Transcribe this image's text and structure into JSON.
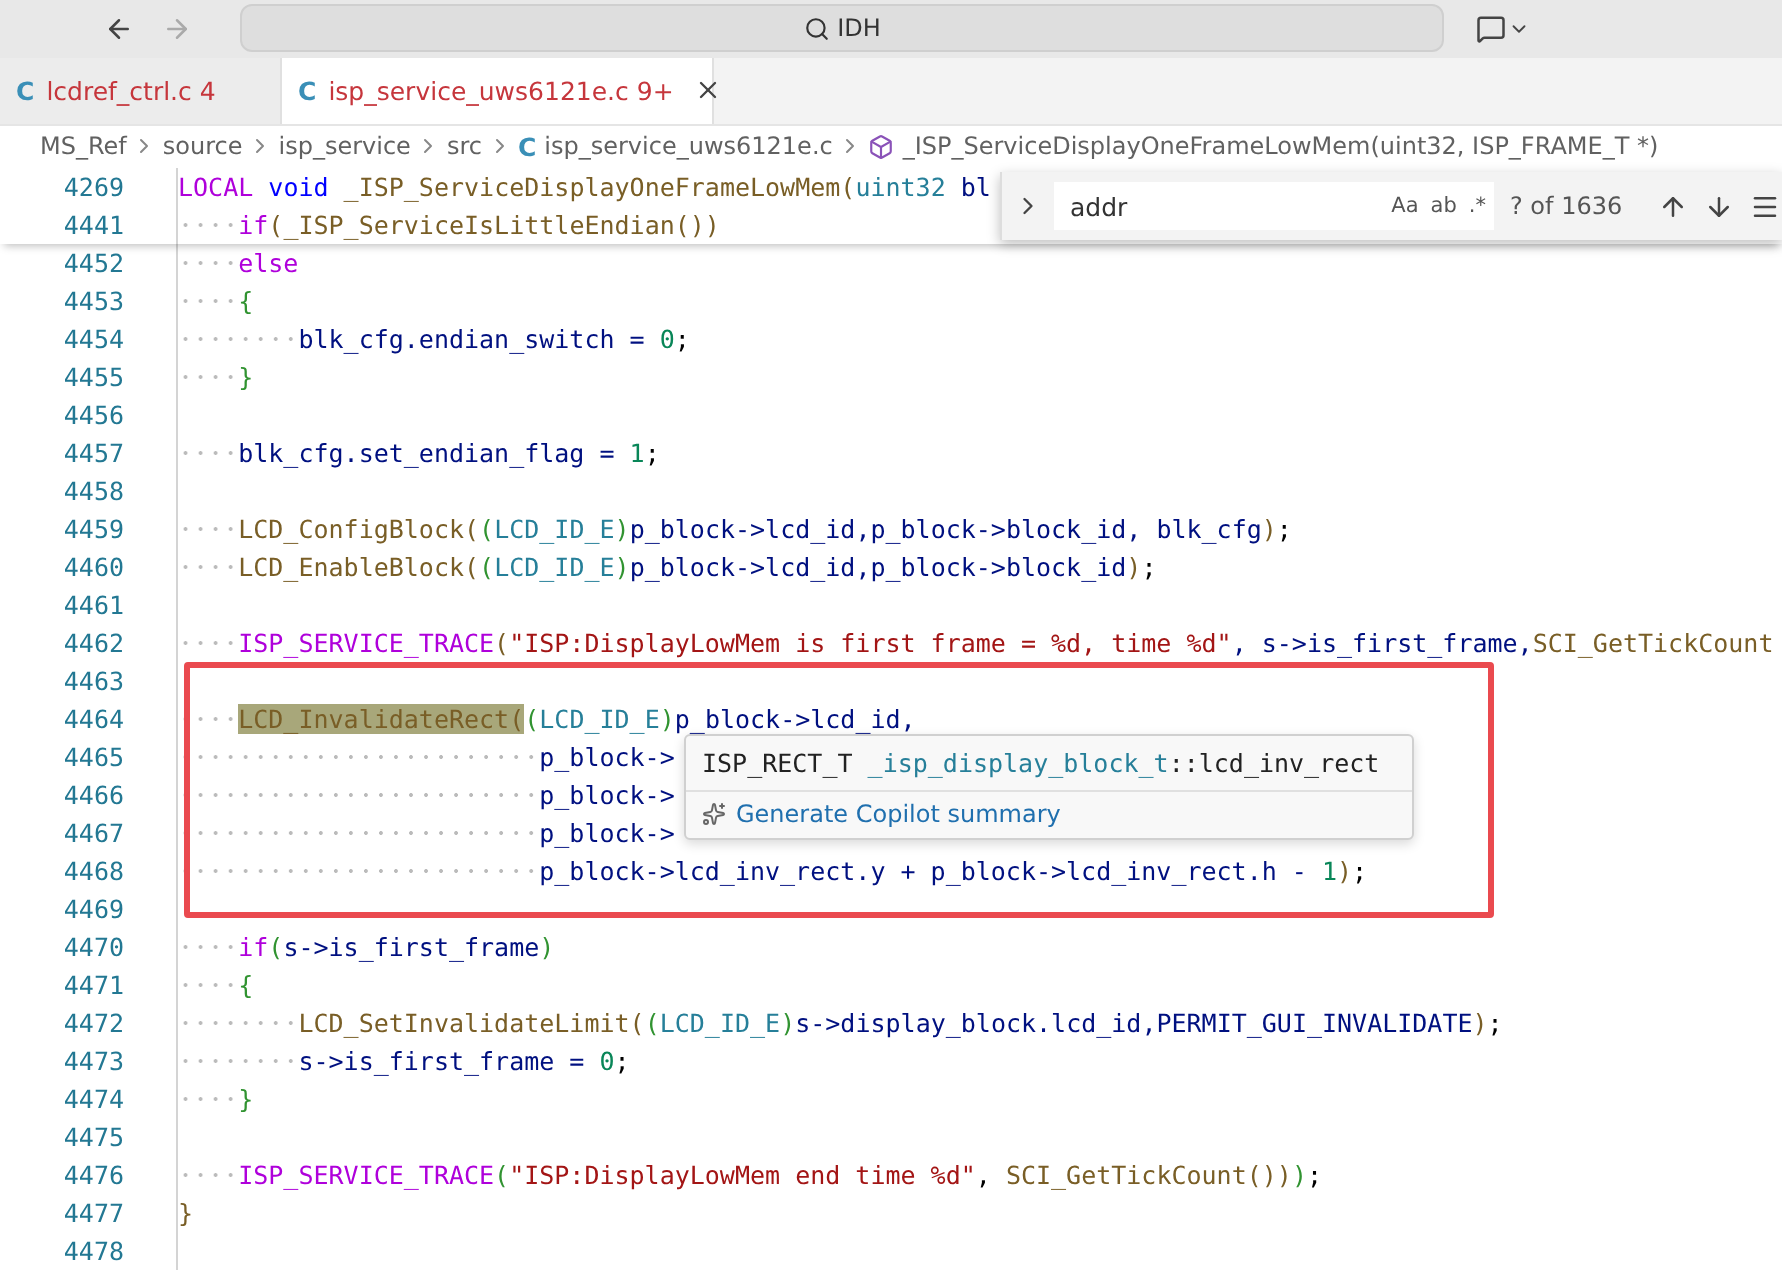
{
  "title_bar": {
    "search": {
      "value": "IDH"
    },
    "back_disabled": false,
    "forward_disabled": true
  },
  "tabs": [
    {
      "icon": "C",
      "label": "lcdref_ctrl.c",
      "badge": "4",
      "selected": false
    },
    {
      "icon": "C",
      "label": "isp_service_uws6121e.c",
      "badge": "9+",
      "selected": true
    }
  ],
  "breadcrumb": [
    {
      "kind": "folder",
      "label": "MS_Ref"
    },
    {
      "kind": "folder",
      "label": "source"
    },
    {
      "kind": "folder",
      "label": "isp_service"
    },
    {
      "kind": "folder",
      "label": "src"
    },
    {
      "kind": "file",
      "icon": "C",
      "label": "isp_service_uws6121e.c"
    },
    {
      "kind": "symbol",
      "label": "_ISP_ServiceDisplayOneFrameLowMem(uint32, ISP_FRAME_T *)"
    }
  ],
  "find_widget": {
    "value": "addr",
    "options": [
      "Aa",
      "ab",
      ".*"
    ],
    "result": "? of 1636"
  },
  "sticky_lines": [
    {
      "number": "4269",
      "tokens": [
        {
          "kind": "kw",
          "text": "LOCAL"
        },
        {
          "kind": "storage",
          "text": " void"
        },
        {
          "kind": "fn",
          "text": " _ISP_ServiceDisplayOneFrameLowMem"
        },
        {
          "kind": "p",
          "text": "("
        },
        {
          "kind": "type",
          "text": "uint32"
        },
        {
          "kind": "var",
          "text": " bl"
        }
      ]
    },
    {
      "number": "4441",
      "tokens": [
        {
          "kind": "kw",
          "text": "    if"
        },
        {
          "kind": "p",
          "text": "("
        },
        {
          "kind": "fn",
          "text": "_ISP_ServiceIsLittleEndian"
        },
        {
          "kind": "p",
          "text": "())"
        }
      ]
    }
  ],
  "lines": [
    {
      "number": "4452",
      "tokens": [
        {
          "kind": "kw",
          "text": "    else"
        }
      ]
    },
    {
      "number": "4453",
      "tokens": [
        {
          "kind": "p2",
          "text": "    {"
        }
      ]
    },
    {
      "number": "4454",
      "tokens": [
        {
          "kind": "var",
          "text": "        blk_cfg.endian_switch ="
        },
        {
          "kind": "num",
          "text": " 0"
        },
        {
          "kind": "op",
          "text": ";"
        }
      ]
    },
    {
      "number": "4455",
      "tokens": [
        {
          "kind": "p2",
          "text": "    }"
        }
      ]
    },
    {
      "number": "4456"
    },
    {
      "number": "4457",
      "tokens": [
        {
          "kind": "var",
          "text": "    blk_cfg.set_endian_flag ="
        },
        {
          "kind": "num",
          "text": " 1"
        },
        {
          "kind": "op",
          "text": ";"
        }
      ]
    },
    {
      "number": "4458"
    },
    {
      "number": "4459",
      "tokens": [
        {
          "kind": "fn",
          "text": "    LCD_ConfigBlock"
        },
        {
          "kind": "p",
          "text": "("
        },
        {
          "kind": "p2",
          "text": "("
        },
        {
          "kind": "type",
          "text": "LCD_ID_E"
        },
        {
          "kind": "p2",
          "text": ")"
        },
        {
          "kind": "var",
          "text": "p_block->lcd_id,p_block->block_id, blk_cfg"
        },
        {
          "kind": "p",
          "text": ")"
        },
        {
          "kind": "op",
          "text": ";"
        }
      ]
    },
    {
      "number": "4460",
      "tokens": [
        {
          "kind": "fn",
          "text": "    LCD_EnableBlock"
        },
        {
          "kind": "p",
          "text": "("
        },
        {
          "kind": "p2",
          "text": "("
        },
        {
          "kind": "type",
          "text": "LCD_ID_E"
        },
        {
          "kind": "p2",
          "text": ")"
        },
        {
          "kind": "var",
          "text": "p_block->lcd_id,p_block->block_id"
        },
        {
          "kind": "p",
          "text": ")"
        },
        {
          "kind": "op",
          "text": ";"
        }
      ]
    },
    {
      "number": "4461"
    },
    {
      "number": "4462",
      "tokens": [
        {
          "kind": "macro",
          "text": "    ISP_SERVICE_TRACE"
        },
        {
          "kind": "p",
          "text": "("
        },
        {
          "kind": "str",
          "text": "\"ISP:DisplayLowMem is first frame = %d, time %d\""
        },
        {
          "kind": "var",
          "text": ", s->is_first_frame,"
        },
        {
          "kind": "fn",
          "text": "SCI_GetTickCount"
        }
      ]
    },
    {
      "number": "4463"
    },
    {
      "number": "4464",
      "tokens": [
        {
          "kind": "fnhl",
          "text": "    LCD_InvalidateRect("
        },
        {
          "kind": "p2",
          "text": "("
        },
        {
          "kind": "type",
          "text": "LCD_ID_E"
        },
        {
          "kind": "p2",
          "text": ")"
        },
        {
          "kind": "var",
          "text": "p_block->lcd_id,"
        }
      ]
    },
    {
      "number": "4465",
      "tokens": [
        {
          "kind": "var",
          "text": "                        p_block->"
        }
      ]
    },
    {
      "number": "4466",
      "tokens": [
        {
          "kind": "var",
          "text": "                        p_block->"
        }
      ]
    },
    {
      "number": "4467",
      "tokens": [
        {
          "kind": "var",
          "text": "                        p_block->"
        }
      ]
    },
    {
      "number": "4468",
      "tokens": [
        {
          "kind": "var",
          "text": "                        p_block->lcd_inv_rect.y + p_block->lcd_inv_rect.h -"
        },
        {
          "kind": "num",
          "text": " 1"
        },
        {
          "kind": "p",
          "text": ")"
        },
        {
          "kind": "op",
          "text": ";"
        }
      ]
    },
    {
      "number": "4469"
    },
    {
      "number": "4470",
      "tokens": [
        {
          "kind": "kw",
          "text": "    if"
        },
        {
          "kind": "p2",
          "text": "("
        },
        {
          "kind": "var",
          "text": "s->is_first_frame"
        },
        {
          "kind": "p2",
          "text": ")"
        }
      ]
    },
    {
      "number": "4471",
      "tokens": [
        {
          "kind": "p2",
          "text": "    {"
        }
      ]
    },
    {
      "number": "4472",
      "tokens": [
        {
          "kind": "fn",
          "text": "        LCD_SetInvalidateLimit"
        },
        {
          "kind": "p",
          "text": "("
        },
        {
          "kind": "p2",
          "text": "("
        },
        {
          "kind": "type",
          "text": "LCD_ID_E"
        },
        {
          "kind": "p2",
          "text": ")"
        },
        {
          "kind": "var",
          "text": "s->display_block.lcd_id,PERMIT_GUI_INVALIDATE"
        },
        {
          "kind": "p",
          "text": ")"
        },
        {
          "kind": "op",
          "text": ";"
        }
      ]
    },
    {
      "number": "4473",
      "tokens": [
        {
          "kind": "var",
          "text": "        s->is_first_frame ="
        },
        {
          "kind": "num",
          "text": " 0"
        },
        {
          "kind": "op",
          "text": ";"
        }
      ]
    },
    {
      "number": "4474",
      "tokens": [
        {
          "kind": "p2",
          "text": "    }"
        }
      ]
    },
    {
      "number": "4475"
    },
    {
      "number": "4476",
      "tokens": [
        {
          "kind": "macro",
          "text": "    ISP_SERVICE_TRACE"
        },
        {
          "kind": "p2",
          "text": "("
        },
        {
          "kind": "str",
          "text": "\"ISP:DisplayLowMem end time %d\""
        },
        {
          "kind": "op",
          "text": ", "
        },
        {
          "kind": "fn",
          "text": "SCI_GetTickCount"
        },
        {
          "kind": "p",
          "text": "())"
        },
        {
          "kind": "p2",
          "text": ")"
        },
        {
          "kind": "op",
          "text": ";"
        }
      ]
    },
    {
      "number": "4477",
      "tokens": [
        {
          "kind": "p",
          "text": "}"
        }
      ]
    },
    {
      "number": "4478"
    }
  ],
  "hover": {
    "signature": [
      {
        "kind": "plain",
        "text": "ISP_RECT_T"
      },
      {
        "kind": "type",
        "text": " _isp_display_block_t"
      },
      {
        "kind": "plain",
        "text": "::lcd_inv_rect"
      }
    ],
    "action": "Generate Copilot summary"
  }
}
